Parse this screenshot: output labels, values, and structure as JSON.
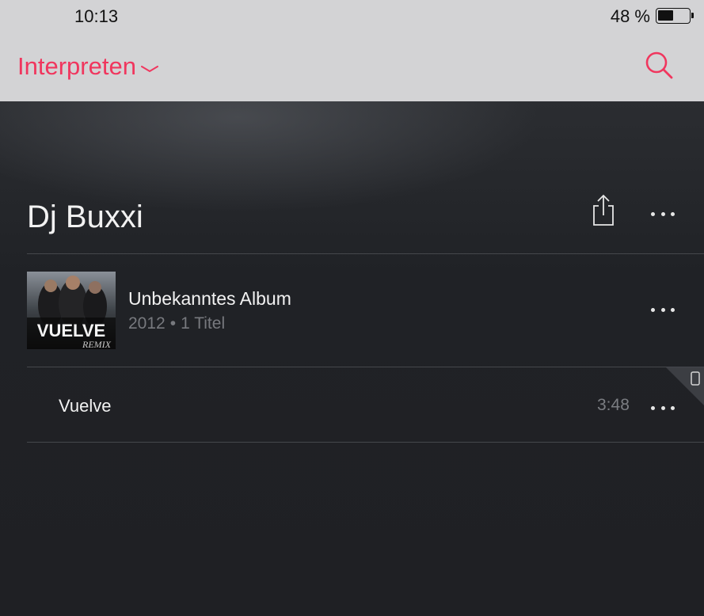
{
  "status_bar": {
    "time": "10:13",
    "battery_text": "48 %",
    "battery_level": 0.48
  },
  "nav": {
    "title": "Interpreten",
    "title_icon": "chevron-down-icon",
    "search_icon": "search-icon"
  },
  "artist": {
    "name": "Dj Buxxi",
    "share_icon": "share-icon",
    "more_icon": "more-dots-icon"
  },
  "album": {
    "title": "Unbekanntes Album",
    "year": "2012",
    "separator": "•",
    "track_count": "1 Titel",
    "art_text": "VUELVE",
    "art_subtext": "REMIX"
  },
  "tracks": [
    {
      "name": "Vuelve",
      "duration": "3:48",
      "device_icon": "device-icon"
    }
  ],
  "colors": {
    "accent": "#f0365e",
    "topbar": "#d3d3d5",
    "background": "#1f2024",
    "secondary_text": "#77797e"
  }
}
